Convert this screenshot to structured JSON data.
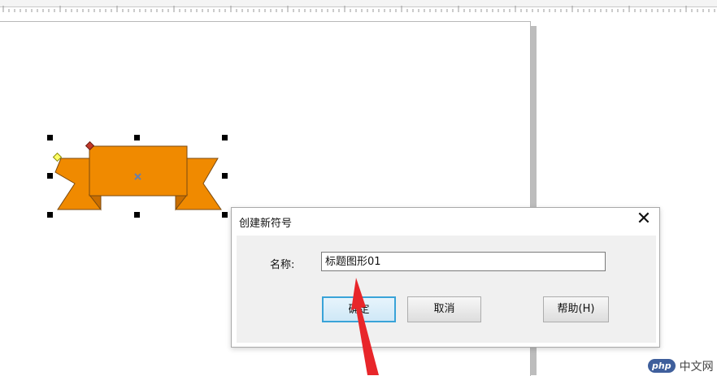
{
  "dialog": {
    "title": "创建新符号",
    "close_icon": "close-icon",
    "name_label": "名称:",
    "name_value": "标题图形01",
    "ok_label": "确定",
    "cancel_label": "取消",
    "help_label": "帮助(H)"
  },
  "watermark": {
    "badge": "php",
    "text": "中文网"
  },
  "colors": {
    "ribbon_fill": "#f08a00",
    "ribbon_stroke": "#7a4a10",
    "arrow": "#e8262a",
    "handle_diamond_yellow": "#ffff66",
    "handle_diamond_red": "#c0392b",
    "focus_button_border": "#39a3d8"
  }
}
